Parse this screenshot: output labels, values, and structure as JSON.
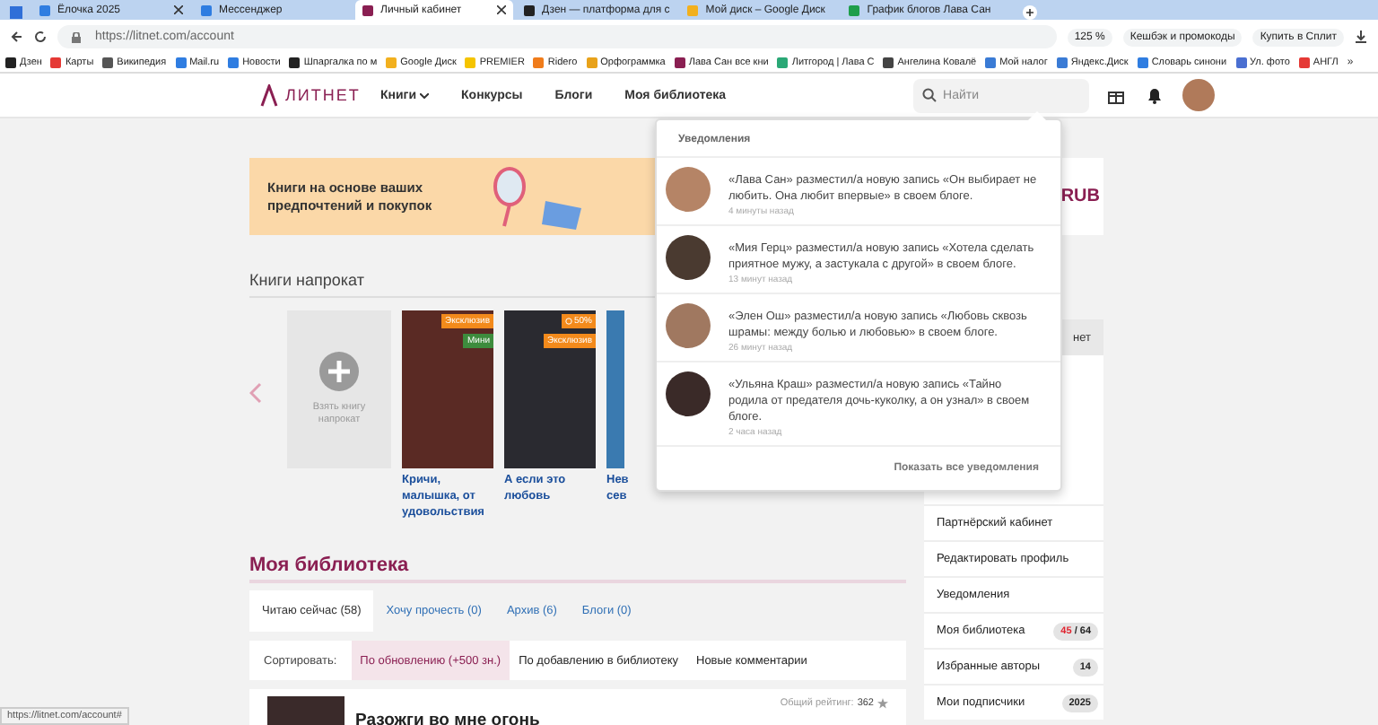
{
  "browser": {
    "tabs": [
      {
        "title": "Ёлочка 2025",
        "selected": false,
        "color": "#2f7de1",
        "closable": true
      },
      {
        "title": "Мессенджер",
        "selected": false,
        "color": "#2f7de1",
        "closable": false
      },
      {
        "title": "Личный кабинет",
        "selected": true,
        "color": "#8a1f52",
        "closable": true
      },
      {
        "title": "Дзен — платформа для с",
        "selected": false,
        "color": "#222222",
        "closable": false
      },
      {
        "title": "Мой диск – Google Диск",
        "selected": false,
        "color": "#f2b01e",
        "closable": false
      },
      {
        "title": "График блогов Лава Сан",
        "selected": false,
        "color": "#1e9e4a",
        "closable": false
      }
    ],
    "url": "https://litnet.com/account",
    "zoom": "125 %",
    "actions": [
      "Кешбэк и промокоды",
      "Купить в Сплит"
    ],
    "bookmarks": [
      {
        "label": "Дзен",
        "color": "#222222"
      },
      {
        "label": "Карты",
        "color": "#e53935"
      },
      {
        "label": "Википедия",
        "color": "#555555"
      },
      {
        "label": "Mail.ru",
        "color": "#2f7de1"
      },
      {
        "label": "Новости",
        "color": "#2f7de1"
      },
      {
        "label": "Шпаргалка по м",
        "color": "#222222"
      },
      {
        "label": "Google Диск",
        "color": "#f2b01e"
      },
      {
        "label": "PREMIER",
        "color": "#f5c400"
      },
      {
        "label": "Ridero",
        "color": "#f07c1b"
      },
      {
        "label": "Орфограммка",
        "color": "#e8a21a"
      },
      {
        "label": "Лава Сан все кни",
        "color": "#8a1f52"
      },
      {
        "label": "Литгород | Лава С",
        "color": "#2aa876"
      },
      {
        "label": "Ангелина Ковалё",
        "color": "#444444"
      },
      {
        "label": "Мой налог",
        "color": "#3a7bd5"
      },
      {
        "label": "Яндекс.Диск",
        "color": "#3a7bd5"
      },
      {
        "label": "Словарь синони",
        "color": "#2f7de1"
      },
      {
        "label": "Ул. фото",
        "color": "#4a6fd1"
      },
      {
        "label": "АНГЛ",
        "color": "#e53935"
      }
    ],
    "more": "»"
  },
  "site": {
    "logo": "ЛИТНЕТ",
    "nav": [
      {
        "label": "Книги",
        "dropdown": true
      },
      {
        "label": "Конкурсы",
        "dropdown": false
      },
      {
        "label": "Блоги",
        "dropdown": false
      },
      {
        "label": "Моя библиотека",
        "dropdown": false
      }
    ],
    "search": {
      "placeholder": "Найти"
    }
  },
  "banner": {
    "text": "Книги на основе ваших предпочтений и покупок"
  },
  "rental": {
    "title": "Книги напрокат",
    "add_label": "Взять книгу напрокат",
    "books": [
      {
        "title": "Кричи, малышка, от удовольствия",
        "color": "#5a2a24",
        "badges": [
          {
            "label": "Эксклюзив",
            "kind": "exclusive"
          },
          {
            "label": "Мини",
            "kind": "mini"
          }
        ]
      },
      {
        "title": "А если это любовь",
        "color": "#2a2a30",
        "badges": [
          {
            "label": "50%",
            "kind": "discount"
          },
          {
            "label": "Эксклюзив",
            "kind": "exclusive"
          }
        ]
      },
      {
        "title": "Нев сев",
        "color": "#3a7ab0"
      }
    ]
  },
  "library": {
    "title": "Моя библиотека",
    "tabs": [
      {
        "label": "Читаю сейчас (58)",
        "selected": true
      },
      {
        "label": "Хочу прочесть (0)",
        "selected": false
      },
      {
        "label": "Архив (6)",
        "selected": false
      },
      {
        "label": "Блоги (0)",
        "selected": false
      }
    ],
    "sort_label": "Сортировать:",
    "sort_options": [
      {
        "label": "По обновлению (+500 зн.)",
        "selected": true
      },
      {
        "label": "По добавлению в библиотеку",
        "selected": false
      },
      {
        "label": "Новые комментарии",
        "selected": false
      }
    ],
    "entry": {
      "title": "Разожги во мне огонь",
      "rating_label": "Общий рейтинг:",
      "rating": "362"
    }
  },
  "sidebar": {
    "balance": "RUB",
    "section": "нет",
    "items": [
      {
        "label": "Партнёрский кабинет"
      },
      {
        "label": "Редактировать профиль"
      },
      {
        "label": "Уведомления"
      },
      {
        "label": "Моя библиотека",
        "badge": "**45** / 64"
      },
      {
        "label": "Избранные авторы",
        "badge": "14"
      },
      {
        "label": "Мои подписчики",
        "badge": "2025"
      }
    ]
  },
  "notifications": {
    "title": "Уведомления",
    "items": [
      {
        "text": "«Лава Сан» разместил/а новую запись «Он выбирает не любить. Она любит впервые» в своем блоге.",
        "time": "4 минуты назад"
      },
      {
        "text": "«Мия Герц» разместил/а новую запись «Хотела сделать приятное мужу, а застукала с другой» в своем блоге.",
        "time": "13 минут назад"
      },
      {
        "text": "«Элен Ош» разместил/а новую запись «Любовь сквозь шрамы: между болью и любовью» в своем блоге.",
        "time": "26 минут назад"
      },
      {
        "text": "«Ульяна Краш» разместил/а новую запись «Тайно родила от предателя дочь-куколку, а он узнал» в своем блоге.",
        "time": "2 часа назад"
      }
    ],
    "footer": "Показать все уведомления"
  },
  "status_url": "https://litnet.com/account#"
}
